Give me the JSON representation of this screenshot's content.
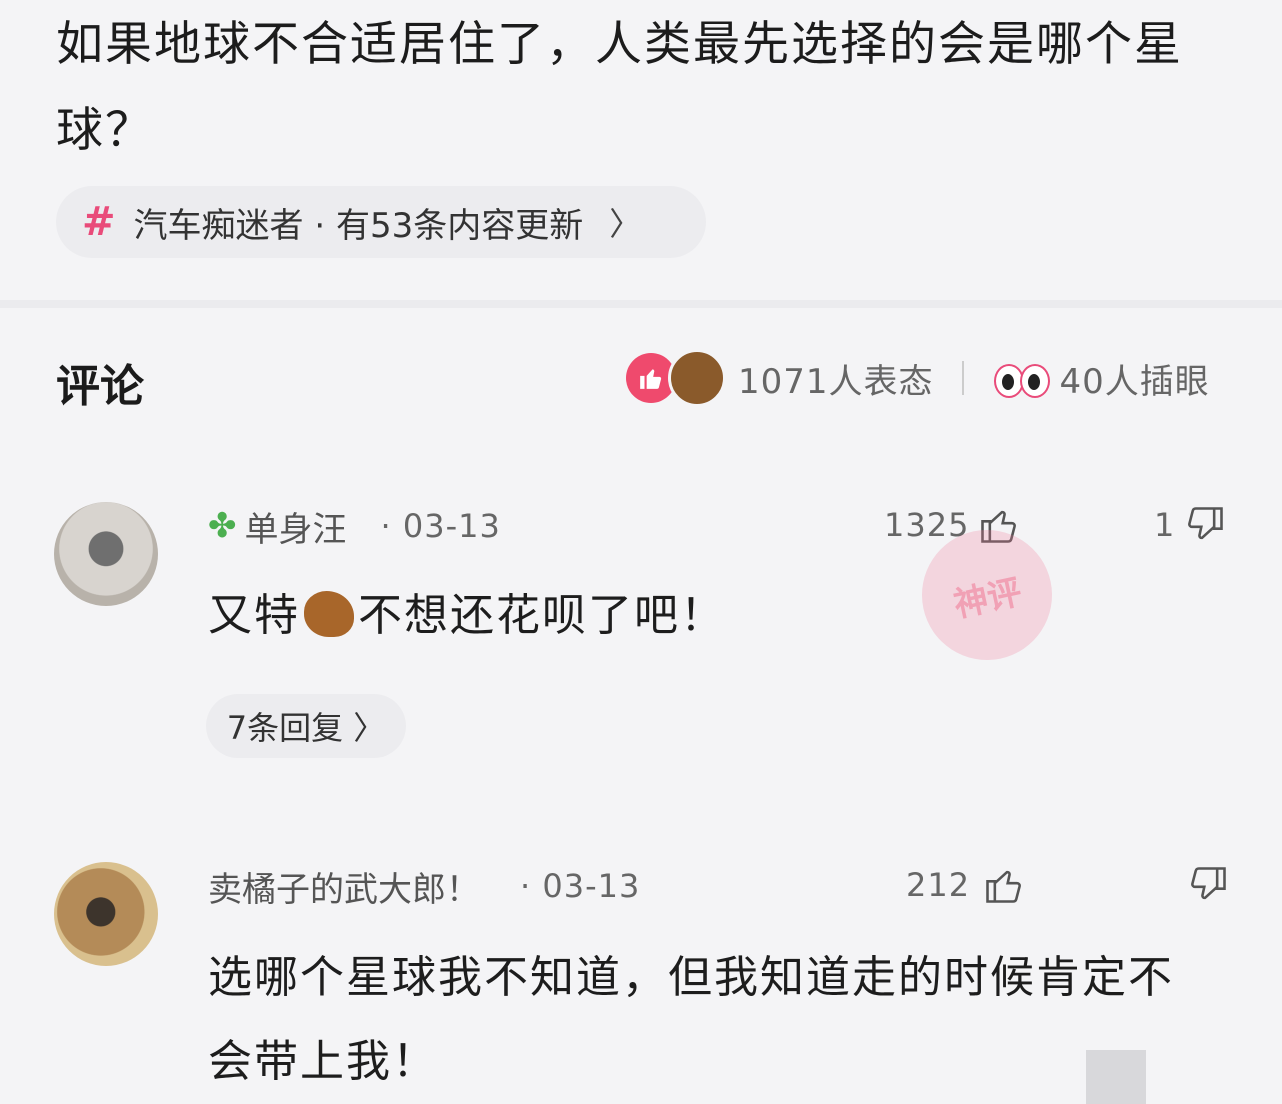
{
  "post": {
    "title": "如果地球不合适居住了，人类最先选择的会是哪个星球？"
  },
  "topic": {
    "icon": "hash-icon",
    "text": "汽车痴迷者 · 有53条内容更新",
    "chevron": "〉"
  },
  "comments_section": {
    "title": "评论",
    "reactions_count": "1071人表态",
    "eye_reactions_count": "40人插眼"
  },
  "comments": [
    {
      "username": "单身汪",
      "badge_icon": "clover-icon",
      "date": "· 03-13",
      "likes": "1325",
      "dislikes": "1",
      "text_before": "又特",
      "inline_emoji": "horse-emoji",
      "text_after": "不想还花呗了吧！",
      "replies": "7条回复 〉"
    },
    {
      "username": "卖橘子的武大郎！",
      "date": "· 03-13",
      "likes": "212",
      "dislikes": "",
      "text": "选哪个星球我不知道，但我知道走的时候肯定不会带上我！"
    }
  ],
  "watermark": "神评",
  "colors": {
    "accent": "#e94b7a",
    "background": "#f4f4f6",
    "chip": "#ececef"
  }
}
